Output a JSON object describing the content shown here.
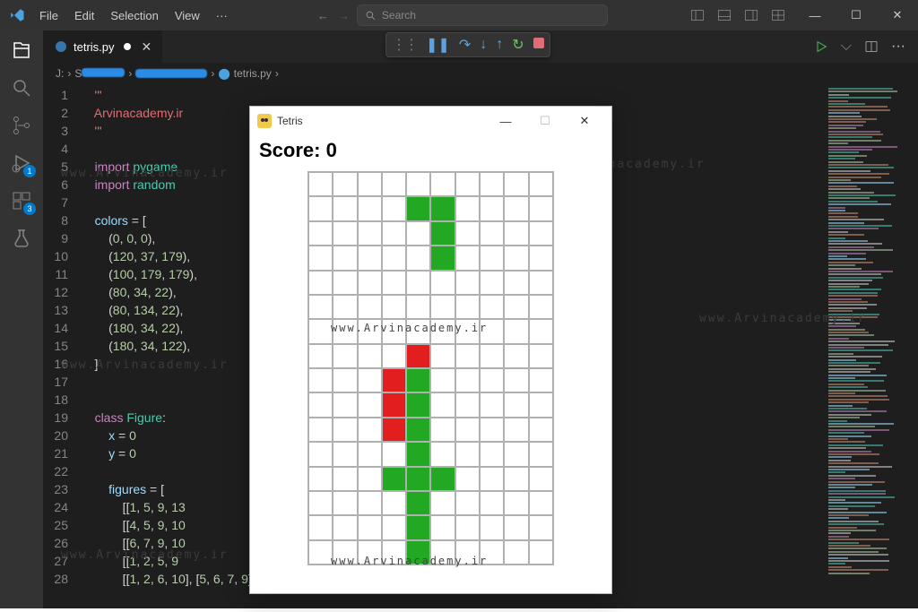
{
  "titlebar": {
    "menus": [
      "File",
      "Edit",
      "Selection",
      "View"
    ],
    "search_placeholder": "Search"
  },
  "tab": {
    "file_label": "tetris.py"
  },
  "breadcrumb": {
    "drive": "J:",
    "file": "tetris.py"
  },
  "watermark": "www.Arvinacademy.ir",
  "code_lines": [
    {
      "n": 1,
      "segs": [
        {
          "t": "    '''",
          "c": "c-str"
        }
      ]
    },
    {
      "n": 2,
      "segs": [
        {
          "t": "    ",
          "c": ""
        },
        {
          "t": "Arvinacademy.ir",
          "c": "c-url"
        }
      ]
    },
    {
      "n": 3,
      "segs": [
        {
          "t": "    '''",
          "c": "c-str"
        }
      ]
    },
    {
      "n": 4,
      "segs": []
    },
    {
      "n": 5,
      "segs": [
        {
          "t": "    ",
          "c": ""
        },
        {
          "t": "import",
          "c": "c-kw"
        },
        {
          "t": " ",
          "c": ""
        },
        {
          "t": "pygame",
          "c": "c-mod"
        }
      ]
    },
    {
      "n": 6,
      "segs": [
        {
          "t": "    ",
          "c": ""
        },
        {
          "t": "import",
          "c": "c-kw"
        },
        {
          "t": " ",
          "c": ""
        },
        {
          "t": "random",
          "c": "c-mod"
        }
      ]
    },
    {
      "n": 7,
      "segs": []
    },
    {
      "n": 8,
      "segs": [
        {
          "t": "    ",
          "c": ""
        },
        {
          "t": "colors",
          "c": "c-var"
        },
        {
          "t": " = [",
          "c": "c-op"
        }
      ]
    },
    {
      "n": 9,
      "segs": [
        {
          "t": "        (",
          "c": ""
        },
        {
          "t": "0",
          "c": "c-num"
        },
        {
          "t": ", ",
          "c": ""
        },
        {
          "t": "0",
          "c": "c-num"
        },
        {
          "t": ", ",
          "c": ""
        },
        {
          "t": "0",
          "c": "c-num"
        },
        {
          "t": "),",
          "c": ""
        }
      ]
    },
    {
      "n": 10,
      "segs": [
        {
          "t": "        (",
          "c": ""
        },
        {
          "t": "120",
          "c": "c-num"
        },
        {
          "t": ", ",
          "c": ""
        },
        {
          "t": "37",
          "c": "c-num"
        },
        {
          "t": ", ",
          "c": ""
        },
        {
          "t": "179",
          "c": "c-num"
        },
        {
          "t": "),",
          "c": ""
        }
      ]
    },
    {
      "n": 11,
      "segs": [
        {
          "t": "        (",
          "c": ""
        },
        {
          "t": "100",
          "c": "c-num"
        },
        {
          "t": ", ",
          "c": ""
        },
        {
          "t": "179",
          "c": "c-num"
        },
        {
          "t": ", ",
          "c": ""
        },
        {
          "t": "179",
          "c": "c-num"
        },
        {
          "t": "),",
          "c": ""
        }
      ]
    },
    {
      "n": 12,
      "segs": [
        {
          "t": "        (",
          "c": ""
        },
        {
          "t": "80",
          "c": "c-num"
        },
        {
          "t": ", ",
          "c": ""
        },
        {
          "t": "34",
          "c": "c-num"
        },
        {
          "t": ", ",
          "c": ""
        },
        {
          "t": "22",
          "c": "c-num"
        },
        {
          "t": "),",
          "c": ""
        }
      ]
    },
    {
      "n": 13,
      "segs": [
        {
          "t": "        (",
          "c": ""
        },
        {
          "t": "80",
          "c": "c-num"
        },
        {
          "t": ", ",
          "c": ""
        },
        {
          "t": "134",
          "c": "c-num"
        },
        {
          "t": ", ",
          "c": ""
        },
        {
          "t": "22",
          "c": "c-num"
        },
        {
          "t": "),",
          "c": ""
        }
      ]
    },
    {
      "n": 14,
      "segs": [
        {
          "t": "        (",
          "c": ""
        },
        {
          "t": "180",
          "c": "c-num"
        },
        {
          "t": ", ",
          "c": ""
        },
        {
          "t": "34",
          "c": "c-num"
        },
        {
          "t": ", ",
          "c": ""
        },
        {
          "t": "22",
          "c": "c-num"
        },
        {
          "t": "),",
          "c": ""
        }
      ]
    },
    {
      "n": 15,
      "segs": [
        {
          "t": "        (",
          "c": ""
        },
        {
          "t": "180",
          "c": "c-num"
        },
        {
          "t": ", ",
          "c": ""
        },
        {
          "t": "34",
          "c": "c-num"
        },
        {
          "t": ", ",
          "c": ""
        },
        {
          "t": "122",
          "c": "c-num"
        },
        {
          "t": "),",
          "c": ""
        }
      ]
    },
    {
      "n": 16,
      "segs": [
        {
          "t": "    ]",
          "c": ""
        }
      ]
    },
    {
      "n": 17,
      "segs": []
    },
    {
      "n": 18,
      "segs": []
    },
    {
      "n": 19,
      "segs": [
        {
          "t": "    ",
          "c": ""
        },
        {
          "t": "class",
          "c": "c-kw"
        },
        {
          "t": " ",
          "c": ""
        },
        {
          "t": "Figure",
          "c": "c-cls"
        },
        {
          "t": ":",
          "c": ""
        }
      ]
    },
    {
      "n": 20,
      "segs": [
        {
          "t": "        ",
          "c": ""
        },
        {
          "t": "x",
          "c": "c-var"
        },
        {
          "t": " = ",
          "c": ""
        },
        {
          "t": "0",
          "c": "c-num"
        }
      ]
    },
    {
      "n": 21,
      "segs": [
        {
          "t": "        ",
          "c": ""
        },
        {
          "t": "y",
          "c": "c-var"
        },
        {
          "t": " = ",
          "c": ""
        },
        {
          "t": "0",
          "c": "c-num"
        }
      ]
    },
    {
      "n": 22,
      "segs": []
    },
    {
      "n": 23,
      "segs": [
        {
          "t": "        ",
          "c": ""
        },
        {
          "t": "figures",
          "c": "c-var"
        },
        {
          "t": " = [",
          "c": ""
        }
      ]
    },
    {
      "n": 24,
      "segs": [
        {
          "t": "            [[",
          "c": ""
        },
        {
          "t": "1",
          "c": "c-num"
        },
        {
          "t": ", ",
          "c": ""
        },
        {
          "t": "5",
          "c": "c-num"
        },
        {
          "t": ", ",
          "c": ""
        },
        {
          "t": "9",
          "c": "c-num"
        },
        {
          "t": ", ",
          "c": ""
        },
        {
          "t": "13",
          "c": "c-num"
        }
      ]
    },
    {
      "n": 25,
      "segs": [
        {
          "t": "            [[",
          "c": ""
        },
        {
          "t": "4",
          "c": "c-num"
        },
        {
          "t": ", ",
          "c": ""
        },
        {
          "t": "5",
          "c": "c-num"
        },
        {
          "t": ", ",
          "c": ""
        },
        {
          "t": "9",
          "c": "c-num"
        },
        {
          "t": ", ",
          "c": ""
        },
        {
          "t": "10",
          "c": "c-num"
        }
      ]
    },
    {
      "n": 26,
      "segs": [
        {
          "t": "            [[",
          "c": ""
        },
        {
          "t": "6",
          "c": "c-num"
        },
        {
          "t": ", ",
          "c": ""
        },
        {
          "t": "7",
          "c": "c-num"
        },
        {
          "t": ", ",
          "c": ""
        },
        {
          "t": "9",
          "c": "c-num"
        },
        {
          "t": ", ",
          "c": ""
        },
        {
          "t": "10",
          "c": "c-num"
        }
      ]
    },
    {
      "n": 27,
      "segs": [
        {
          "t": "            [[",
          "c": ""
        },
        {
          "t": "1",
          "c": "c-num"
        },
        {
          "t": ", ",
          "c": ""
        },
        {
          "t": "2",
          "c": "c-num"
        },
        {
          "t": ", ",
          "c": ""
        },
        {
          "t": "5",
          "c": "c-num"
        },
        {
          "t": ", ",
          "c": ""
        },
        {
          "t": "9",
          "c": "c-num"
        }
      ]
    },
    {
      "n": 28,
      "segs": [
        {
          "t": "            [[",
          "c": ""
        },
        {
          "t": "1",
          "c": "c-num"
        },
        {
          "t": ", ",
          "c": ""
        },
        {
          "t": "2",
          "c": "c-num"
        },
        {
          "t": ", ",
          "c": ""
        },
        {
          "t": "6",
          "c": "c-num"
        },
        {
          "t": ", ",
          "c": ""
        },
        {
          "t": "10",
          "c": "c-num"
        },
        {
          "t": "], [",
          "c": ""
        },
        {
          "t": "5",
          "c": "c-num"
        },
        {
          "t": ", ",
          "c": ""
        },
        {
          "t": "6",
          "c": "c-num"
        },
        {
          "t": ", ",
          "c": ""
        },
        {
          "t": "7",
          "c": "c-num"
        },
        {
          "t": ", ",
          "c": ""
        },
        {
          "t": "9",
          "c": "c-num"
        },
        {
          "t": "], [",
          "c": ""
        }
      ]
    }
  ],
  "activity_badges": {
    "debug": "1",
    "ext": "3"
  },
  "tetris": {
    "title": "Tetris",
    "score_label": "Score: 0",
    "grid": {
      "cols": 10,
      "rows": 16
    },
    "cells": {
      "green": [
        [
          1,
          4
        ],
        [
          1,
          5
        ],
        [
          2,
          5
        ],
        [
          3,
          5
        ],
        [
          8,
          4
        ],
        [
          9,
          4
        ],
        [
          10,
          4
        ],
        [
          11,
          4
        ],
        [
          12,
          3
        ],
        [
          12,
          4
        ],
        [
          12,
          5
        ],
        [
          13,
          4
        ],
        [
          14,
          4
        ],
        [
          15,
          4
        ]
      ],
      "red": [
        [
          7,
          4
        ],
        [
          8,
          3
        ],
        [
          9,
          3
        ],
        [
          10,
          3
        ]
      ]
    }
  }
}
